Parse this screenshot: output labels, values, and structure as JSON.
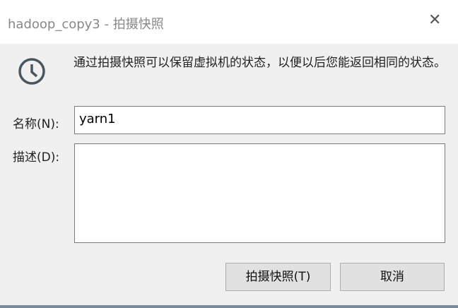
{
  "window": {
    "title": "hadoop_copy3 - 拍摄快照"
  },
  "message": "通过拍摄快照可以保留虚拟机的状态，以便以后您能返回相同的状态。",
  "form": {
    "name_label": "名称(N):",
    "name_value": "yarn1",
    "desc_label": "描述(D):",
    "desc_value": ""
  },
  "buttons": {
    "snapshot": "拍摄快照(T)",
    "cancel": "取消"
  }
}
